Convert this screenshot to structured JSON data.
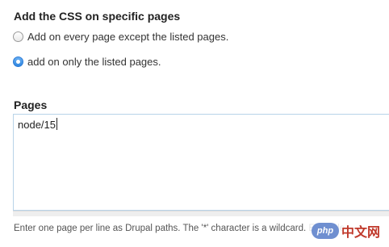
{
  "section": {
    "title": "Add the CSS on specific pages"
  },
  "visibility": {
    "options": [
      {
        "label": "Add on every page except the listed pages.",
        "checked": false
      },
      {
        "label": "add on only the listed pages.",
        "checked": true
      }
    ]
  },
  "pages": {
    "label": "Pages",
    "value": "node/15"
  },
  "help": {
    "text": "Enter one page per line as Drupal paths. The '*' character is a wildcard. Example"
  },
  "watermark": {
    "logo": "php",
    "text": "中文网"
  },
  "colors": {
    "radio_checked": "#2f86e0",
    "textarea_border": "#b8d3e8"
  }
}
